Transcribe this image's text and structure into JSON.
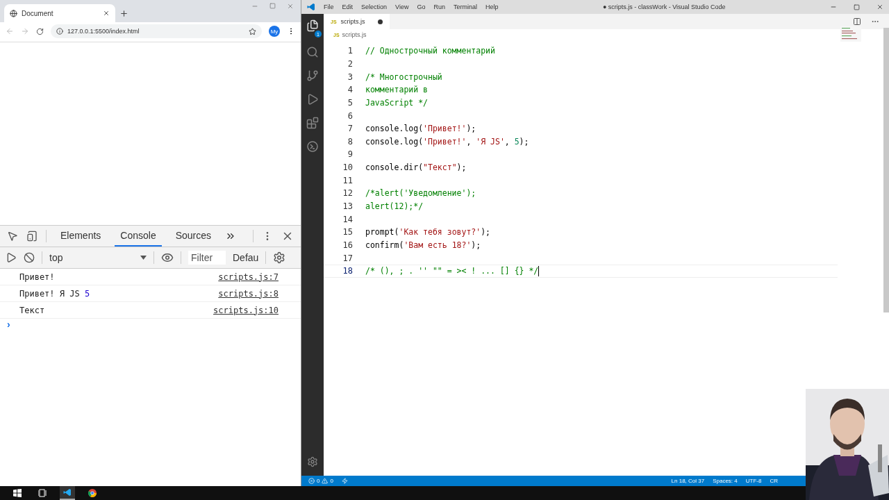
{
  "browser": {
    "tab": {
      "title": "Document"
    },
    "address": "127.0.0.1:5500/index.html",
    "profile": "My",
    "devtools": {
      "tabs": [
        {
          "label": "Elements",
          "selected": false
        },
        {
          "label": "Console",
          "selected": true
        },
        {
          "label": "Sources",
          "selected": false
        }
      ],
      "context": "top",
      "filter_placeholder": "Filter",
      "levels": "Defau",
      "messages": [
        {
          "parts": [
            {
              "kind": "text",
              "text": "Привет!"
            }
          ],
          "source": "scripts.js:7"
        },
        {
          "parts": [
            {
              "kind": "text",
              "text": "Привет! Я JS "
            },
            {
              "kind": "number",
              "text": "5"
            }
          ],
          "source": "scripts.js:8"
        },
        {
          "parts": [
            {
              "kind": "text",
              "text": "Текст"
            }
          ],
          "source": "scripts.js:10"
        }
      ],
      "prompt": "›"
    }
  },
  "vscode": {
    "menu": [
      "File",
      "Edit",
      "Selection",
      "View",
      "Go",
      "Run",
      "Terminal",
      "Help"
    ],
    "title": "● scripts.js - classWork - Visual Studio Code",
    "explorer_badge": "1",
    "tab": {
      "icon": "JS",
      "label": "scripts.js",
      "modified": true
    },
    "breadcrumb": {
      "icon": "JS",
      "label": "scripts.js"
    },
    "lines": [
      {
        "number": "1",
        "tokens": [
          {
            "kind": "comment",
            "text": "// Однострочный комментарий"
          }
        ]
      },
      {
        "number": "2"
      },
      {
        "number": "3",
        "tokens": [
          {
            "kind": "comment",
            "text": "/* Многострочный"
          }
        ]
      },
      {
        "number": "4",
        "tokens": [
          {
            "kind": "comment",
            "text": "комментарий в"
          }
        ]
      },
      {
        "number": "5",
        "tokens": [
          {
            "kind": "comment",
            "text": "JavaScript */"
          }
        ]
      },
      {
        "number": "6"
      },
      {
        "number": "7",
        "tokens": [
          {
            "kind": "plain",
            "text": "console.log("
          },
          {
            "kind": "string",
            "text": "'Привет!'"
          },
          {
            "kind": "plain",
            "text": ");"
          }
        ]
      },
      {
        "number": "8",
        "tokens": [
          {
            "kind": "plain",
            "text": "console.log("
          },
          {
            "kind": "string",
            "text": "'Привет!'"
          },
          {
            "kind": "plain",
            "text": ", "
          },
          {
            "kind": "string",
            "text": "'Я JS'"
          },
          {
            "kind": "plain",
            "text": ", "
          },
          {
            "kind": "number",
            "text": "5"
          },
          {
            "kind": "plain",
            "text": ");"
          }
        ]
      },
      {
        "number": "9"
      },
      {
        "number": "10",
        "tokens": [
          {
            "kind": "plain",
            "text": "console.dir("
          },
          {
            "kind": "string",
            "text": "\"Текст\""
          },
          {
            "kind": "plain",
            "text": ");"
          }
        ]
      },
      {
        "number": "11"
      },
      {
        "number": "12",
        "tokens": [
          {
            "kind": "comment",
            "text": "/*alert('Уведомление');"
          }
        ]
      },
      {
        "number": "13",
        "tokens": [
          {
            "kind": "comment",
            "text": "alert(12);*/"
          }
        ]
      },
      {
        "number": "14"
      },
      {
        "number": "15",
        "tokens": [
          {
            "kind": "plain",
            "text": "prompt("
          },
          {
            "kind": "string",
            "text": "'Как тебя зовут?'"
          },
          {
            "kind": "plain",
            "text": ");"
          }
        ]
      },
      {
        "number": "16",
        "tokens": [
          {
            "kind": "plain",
            "text": "confirm("
          },
          {
            "kind": "string",
            "text": "'Вам есть 18?'"
          },
          {
            "kind": "plain",
            "text": ");"
          }
        ]
      },
      {
        "number": "17"
      },
      {
        "number": "18",
        "tokens": [
          {
            "kind": "comment",
            "text": "/* (), ; . '' \"\" = >< ! ... [] {} */"
          }
        ],
        "current": true
      }
    ],
    "status": {
      "errors": "0",
      "warnings": "0",
      "position": "Ln 18, Col 37",
      "spaces": "Spaces: 4",
      "encoding": "UTF-8",
      "eol": "CR"
    }
  }
}
